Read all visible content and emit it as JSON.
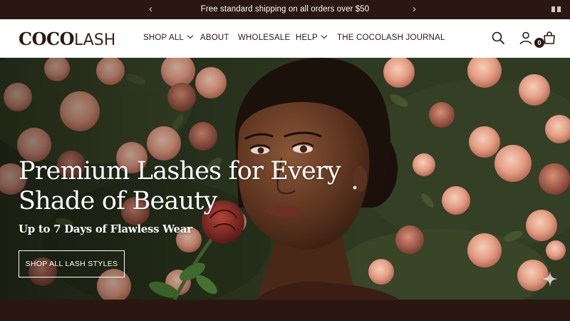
{
  "announcement": {
    "message": "Free standard shipping on all orders over $50",
    "prev_arrow": "‹",
    "next_arrow": "›"
  },
  "header": {
    "logo_bold": "COCO",
    "logo_thin": "LASH",
    "nav": [
      {
        "label": "SHOP ALL",
        "dropdown": true
      },
      {
        "label": "ABOUT",
        "dropdown": false
      },
      {
        "label": "WHOLESALE",
        "dropdown": false
      },
      {
        "label": "HELP",
        "dropdown": true
      },
      {
        "label": "THE COCOLASH JOURNAL",
        "dropdown": false
      }
    ],
    "icons": [
      "search-icon",
      "account-icon",
      "cart-icon"
    ],
    "cart_count": "0"
  },
  "hero": {
    "title": "Premium Lashes for Every Shade of Beauty",
    "subtitle": "Up to 7 Days of Flawless Wear",
    "cta": "SHOP ALL LASH STYLES"
  },
  "colors": {
    "brand_dark": "#2b1712",
    "white": "#ffffff",
    "rose": "#e9a38d",
    "foliage": "#2f3b22"
  }
}
